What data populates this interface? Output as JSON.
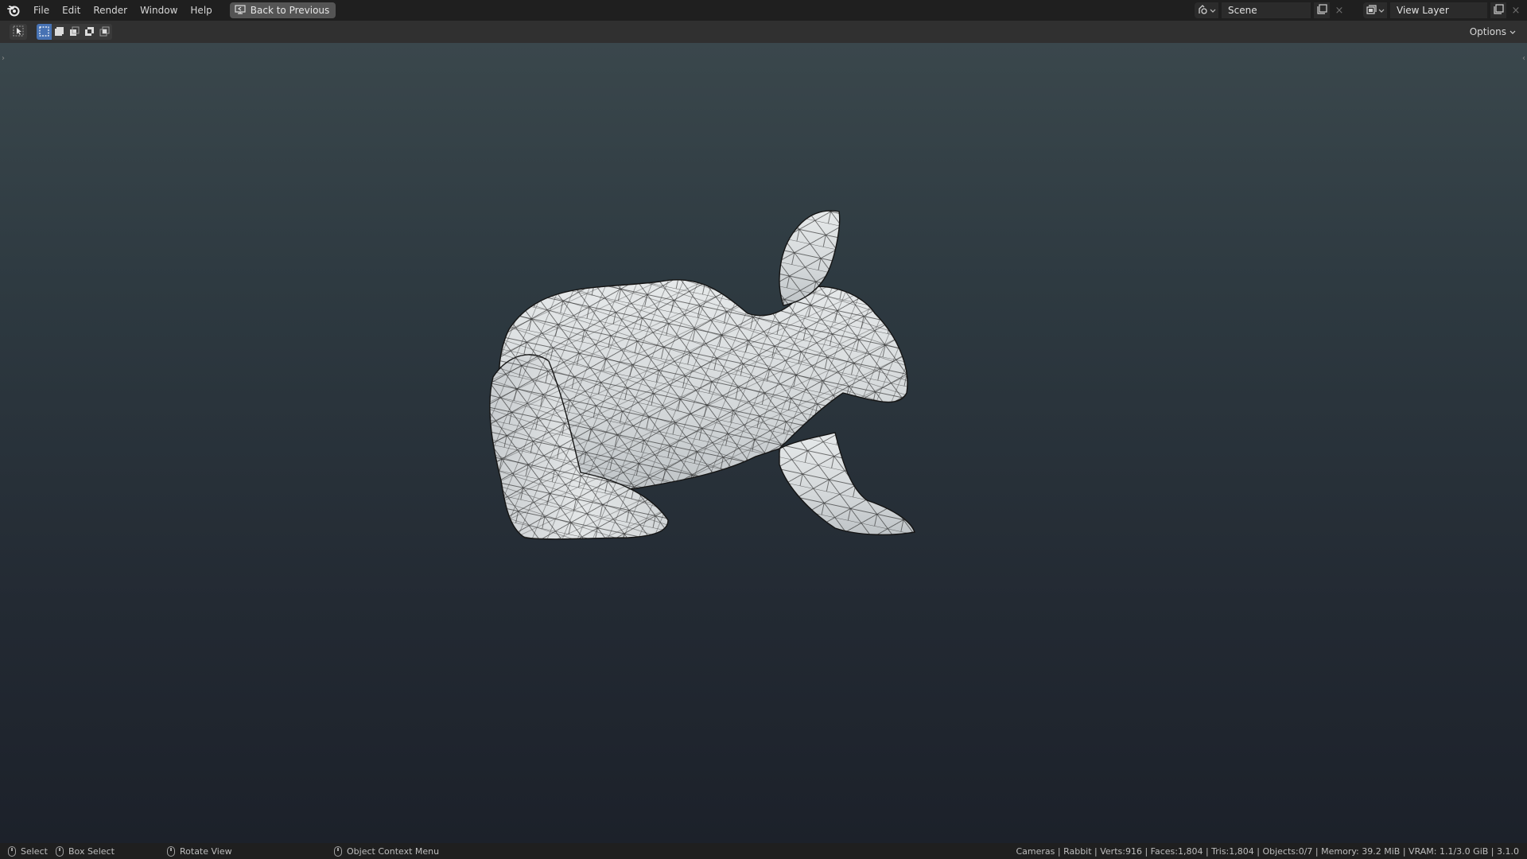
{
  "topbar": {
    "menu": [
      "File",
      "Edit",
      "Render",
      "Window",
      "Help"
    ],
    "back_label": "Back to Previous",
    "scene_name": "Scene",
    "view_layer_name": "View Layer",
    "close_glyph": "×"
  },
  "header": {
    "options_label": "Options"
  },
  "statusbar": {
    "hints": [
      "Select",
      "Box Select",
      "Rotate View",
      "Object Context Menu"
    ],
    "stats": "Cameras | Rabbit | Verts:916 | Faces:1,804 | Tris:1,804 | Objects:0/7 | Memory: 39.2 MiB | VRAM: 1.1/3.0 GiB | 3.1.0"
  },
  "icons": {
    "logo": "blender-logo-icon",
    "back": "back-to-previous-icon",
    "scene": "scene-icon",
    "view_layer": "view-layer-icon",
    "copy": "duplicate-icon",
    "select_tool": "select-cursor-icon",
    "mouse": "mouse-button-icon"
  },
  "colors": {
    "active_mode": "#4772b3",
    "viewport_top": "#3a474c",
    "viewport_bottom": "#1c212a",
    "mesh_fill": "#d9dcde",
    "wire": "#1a1a1a"
  }
}
